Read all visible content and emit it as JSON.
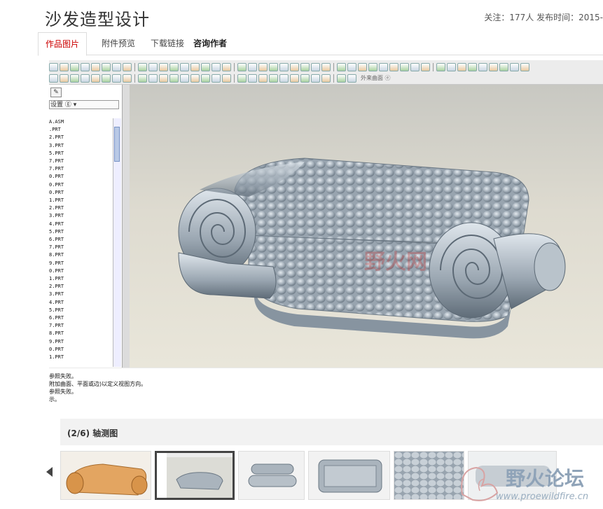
{
  "page": {
    "title": "沙发造型设计",
    "meta": "关注：177人  发布时间：2015-"
  },
  "tabs": [
    {
      "label": "作品图片",
      "active": true
    },
    {
      "label": "附件预览"
    },
    {
      "label": "下载链接"
    },
    {
      "label": "咨询作者"
    }
  ],
  "app": {
    "toolbar_text": "外来曲面 ⓔ",
    "settings_label": "设置 ⓖ ▾",
    "tree_items": [
      "A.ASM",
      ".PRT",
      "2.PRT",
      "3.PRT",
      "5.PRT",
      "7.PRT",
      "7.PRT",
      "0.PRT",
      "0.PRT",
      "0.PRT",
      "1.PRT",
      "2.PRT",
      "3.PRT",
      "4.PRT",
      "5.PRT",
      "6.PRT",
      "7.PRT",
      "8.PRT",
      "9.PRT",
      "0.PRT",
      "1.PRT",
      "2.PRT",
      "3.PRT",
      "4.PRT",
      "5.PRT",
      "6.PRT",
      "7.PRT",
      "8.PRT",
      "9.PRT",
      "0.PRT",
      "1.PRT"
    ],
    "messages": [
      "参照失败。",
      "附加曲面、平面或边)以定义视图方向。",
      "参照失败。",
      "",
      "示。"
    ],
    "viewport_watermark": "野火网"
  },
  "gallery": {
    "caption": "(2/6) 轴测图",
    "watermark_cn": "野火论坛",
    "watermark_url": "www.proewildfire.cn"
  },
  "colors": {
    "accent": "#cc0000",
    "sofa_gray": "#aab4bd",
    "sofa_orange": "#e3a561"
  }
}
